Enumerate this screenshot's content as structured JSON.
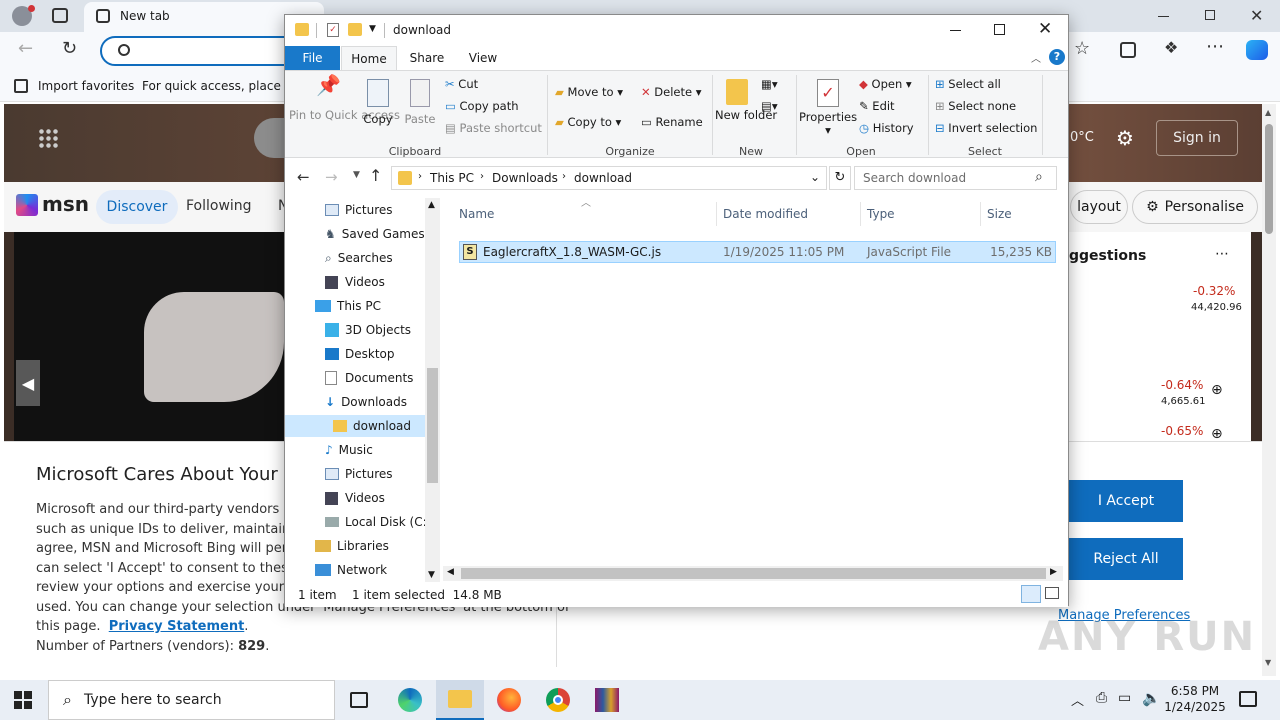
{
  "edge": {
    "tab_title": "New tab",
    "favorites": {
      "import_label": "Import favorites",
      "hint": "For quick access, place you"
    },
    "msn": {
      "logo": "msn",
      "nav": [
        "Discover",
        "Following",
        "N"
      ],
      "sign_in": "Sign in",
      "temp": "0°C",
      "layout_label": "layout",
      "personalise_label": "Personalise",
      "suggestions_label": "ggestions",
      "stocks": [
        {
          "change": "-0.32%",
          "value": "44,420.96"
        },
        {
          "change": "-0.64%",
          "value": "4,665.61"
        },
        {
          "change": "-0.65%",
          "value": ""
        }
      ]
    },
    "consent": {
      "title": "Microsoft Cares About Your P",
      "lines": [
        "Microsoft and our third-party vendors use",
        "such as unique IDs to deliver, maintain anc",
        "agree, MSN and Microsoft Bing will persor",
        "can select 'I Accept' to consent to these us",
        "review your options and exercise your righ",
        "used.  You can change your selection under 'Manage Preferences' at the bottom of"
      ],
      "line7_prefix": "this page.",
      "privacy_link": "Privacy Statement",
      "partners_label": "Number of Partners (vendors):",
      "partners_count": "829",
      "accept": "I Accept",
      "reject": "Reject All",
      "manage": "Manage Preferences"
    }
  },
  "explorer": {
    "title": "download",
    "tabs": [
      "File",
      "Home",
      "Share",
      "View"
    ],
    "ribbon": {
      "clipboard": {
        "pin": "Pin to Quick access",
        "copy": "Copy",
        "paste": "Paste",
        "cut": "Cut",
        "copy_path": "Copy path",
        "paste_shortcut": "Paste shortcut",
        "label": "Clipboard"
      },
      "organize": {
        "move_to": "Move to",
        "copy_to": "Copy to",
        "delete": "Delete",
        "rename": "Rename",
        "label": "Organize"
      },
      "new": {
        "new_folder": "New folder",
        "label": "New"
      },
      "open": {
        "properties": "Properties",
        "open": "Open",
        "edit": "Edit",
        "history": "History",
        "label": "Open"
      },
      "select": {
        "select_all": "Select all",
        "select_none": "Select none",
        "invert": "Invert selection",
        "label": "Select"
      }
    },
    "breadcrumb": [
      "This PC",
      "Downloads",
      "download"
    ],
    "search_placeholder": "Search download",
    "nav": [
      "Pictures",
      "Saved Games",
      "Searches",
      "Videos",
      "This PC",
      "3D Objects",
      "Desktop",
      "Documents",
      "Downloads",
      "download",
      "Music",
      "Pictures",
      "Videos",
      "Local Disk (C:)",
      "Libraries",
      "Network"
    ],
    "columns": [
      "Name",
      "Date modified",
      "Type",
      "Size"
    ],
    "files": [
      {
        "name": "EaglercraftX_1.8_WASM-GC.js",
        "date": "1/19/2025 11:05 PM",
        "type": "JavaScript File",
        "size": "15,235 KB"
      }
    ],
    "status": {
      "count": "1 item",
      "selected": "1 item selected  14.8 MB"
    }
  },
  "taskbar": {
    "search_placeholder": "Type here to search",
    "time": "6:58 PM",
    "date": "1/24/2025"
  },
  "watermark": "ANY RUN"
}
